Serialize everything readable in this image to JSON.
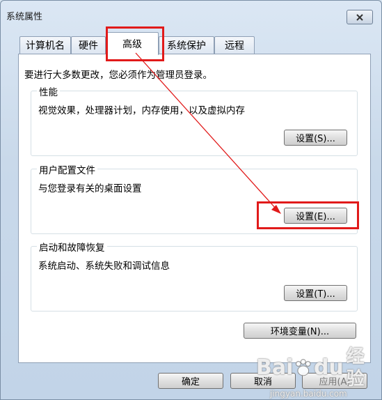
{
  "window": {
    "title": "系统属性"
  },
  "tabs": [
    {
      "label": "计算机名"
    },
    {
      "label": "硬件"
    },
    {
      "label": "高级"
    },
    {
      "label": "系统保护"
    },
    {
      "label": "远程"
    }
  ],
  "advanced": {
    "intro": "要进行大多数更改，您必须作为管理员登录。",
    "performance": {
      "title": "性能",
      "desc": "视觉效果，处理器计划，内存使用，以及虚拟内存",
      "button": "设置(S)..."
    },
    "user_profiles": {
      "title": "用户配置文件",
      "desc": "与您登录有关的桌面设置",
      "button": "设置(E)..."
    },
    "startup_recovery": {
      "title": "启动和故障恢复",
      "desc": "系统启动、系统失败和调试信息",
      "button": "设置(T)..."
    },
    "env_button": "环境变量(N)..."
  },
  "footer": {
    "ok": "确定",
    "cancel": "取消",
    "apply": "应用(A)"
  },
  "watermark": {
    "brand": "Bai",
    "brand_tail": "du",
    "suffix": "经验",
    "url": "jingyan.baidu.com"
  },
  "colors": {
    "annotation": "#e11a1a"
  }
}
